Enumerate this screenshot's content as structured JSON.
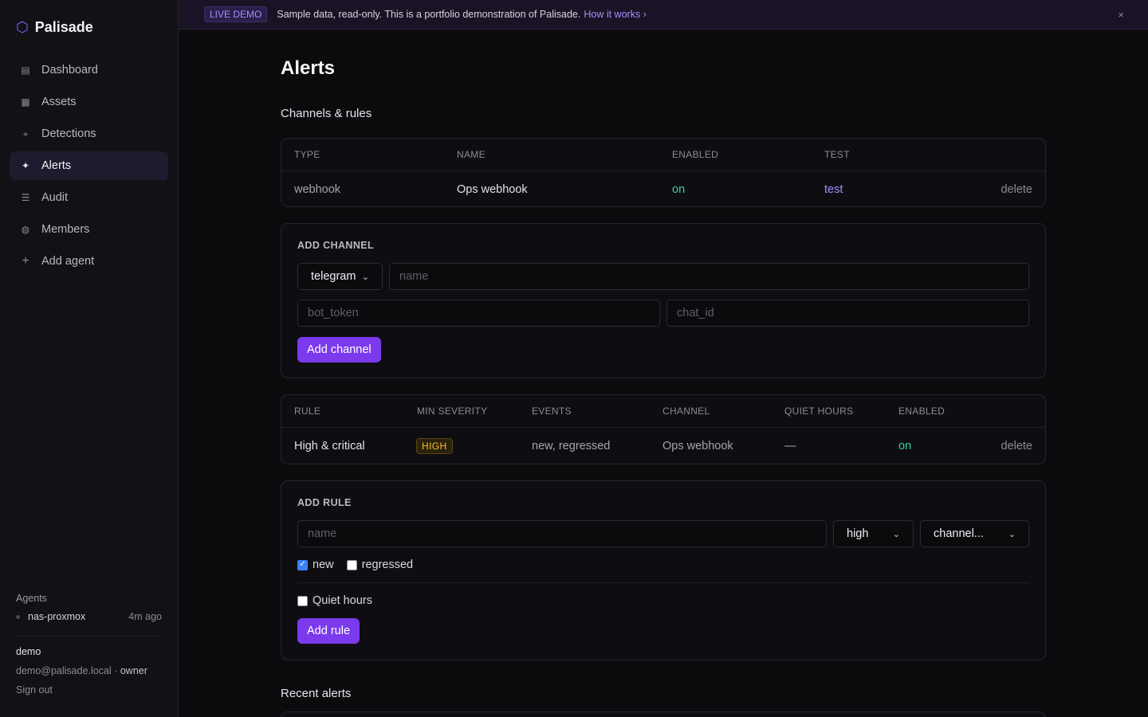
{
  "app": {
    "name": "Palisade"
  },
  "sidebar": {
    "items": [
      {
        "label": "Dashboard",
        "icon": "dashboard-icon",
        "glyph": "▤"
      },
      {
        "label": "Assets",
        "icon": "assets-icon",
        "glyph": "▦"
      },
      {
        "label": "Detections",
        "icon": "detections-icon",
        "glyph": "⌖"
      },
      {
        "label": "Alerts",
        "icon": "alerts-icon",
        "glyph": "✦",
        "active": true
      },
      {
        "label": "Audit",
        "icon": "audit-icon",
        "glyph": "☰"
      },
      {
        "label": "Members",
        "icon": "members-icon",
        "glyph": "◍"
      },
      {
        "label": "Add agent",
        "icon": "plus-icon",
        "glyph": "+"
      }
    ],
    "agents_title": "Agents",
    "agents": [
      {
        "name": "nas-proxmox",
        "last_seen": "4m ago"
      }
    ],
    "user": {
      "name": "demo",
      "email": "demo@palisade.local",
      "separator": "·",
      "role": "owner"
    },
    "sign_out": "Sign out"
  },
  "banner": {
    "badge": "LIVE DEMO",
    "text": "Sample data, read-only. This is a portfolio demonstration of Palisade.",
    "link": "How it works ›",
    "close": "×"
  },
  "page": {
    "title": "Alerts"
  },
  "channels": {
    "section_title": "Channels & rules",
    "columns": [
      "TYPE",
      "NAME",
      "ENABLED",
      "TEST"
    ],
    "rows": [
      {
        "type": "webhook",
        "name": "Ops webhook",
        "enabled": "on",
        "test": "test",
        "delete": "delete"
      }
    ]
  },
  "add_channel": {
    "title": "ADD CHANNEL",
    "type_value": "telegram",
    "name_placeholder": "name",
    "bot_token_placeholder": "bot_token",
    "chat_id_placeholder": "chat_id",
    "button": "Add channel"
  },
  "rules": {
    "columns": [
      "RULE",
      "MIN SEVERITY",
      "EVENTS",
      "CHANNEL",
      "QUIET HOURS",
      "ENABLED"
    ],
    "rows": [
      {
        "rule": "High & critical",
        "severity": "HIGH",
        "events": "new, regressed",
        "channel": "Ops webhook",
        "quiet_hours": "—",
        "enabled": "on",
        "delete": "delete"
      }
    ]
  },
  "add_rule": {
    "title": "ADD RULE",
    "name_placeholder": "name",
    "severity_value": "high",
    "channel_value": "channel...",
    "events": [
      {
        "label": "new",
        "checked": true
      },
      {
        "label": "regressed",
        "checked": false
      }
    ],
    "quiet_hours_label": "Quiet hours",
    "quiet_hours_checked": false,
    "button": "Add rule"
  },
  "recent": {
    "section_title": "Recent alerts"
  },
  "colors": {
    "accent": "#7c3aed",
    "link": "#a78bfa",
    "success": "#34d399",
    "warning": "#fbbf24"
  }
}
